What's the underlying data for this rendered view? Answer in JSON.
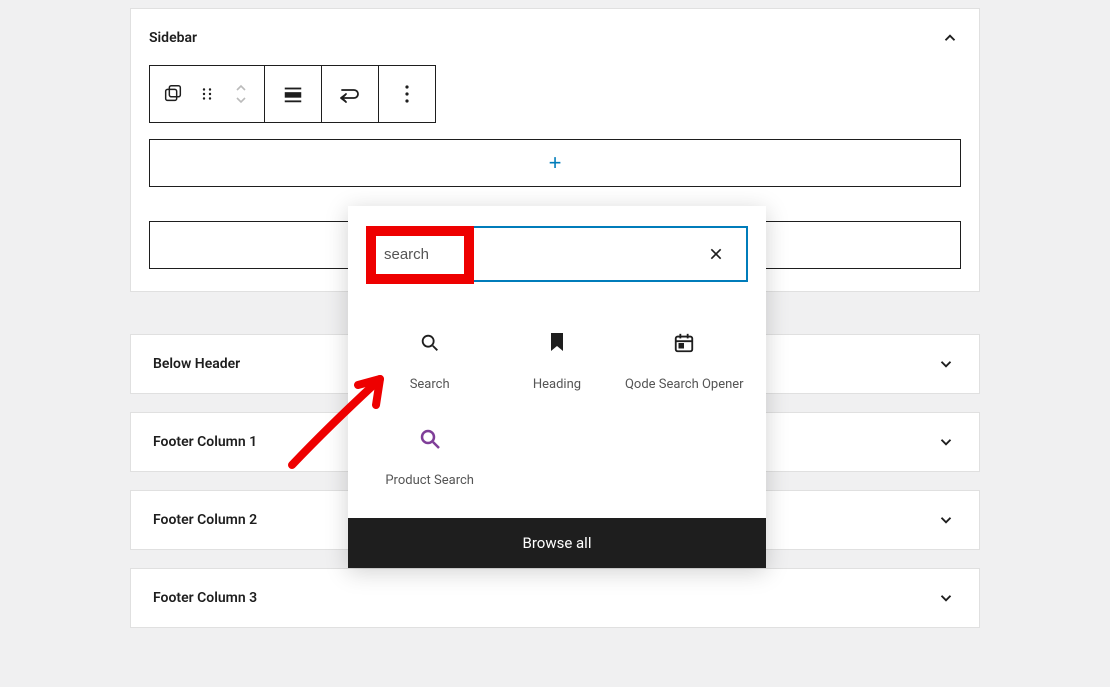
{
  "sidebar": {
    "title": "Sidebar"
  },
  "inserter": {
    "search_value": "search",
    "search_placeholder": "Search",
    "browse_all": "Browse all",
    "blocks": [
      {
        "label": "Search",
        "icon": "search"
      },
      {
        "label": "Heading",
        "icon": "bookmark"
      },
      {
        "label": "Qode Search Opener",
        "icon": "calendar"
      },
      {
        "label": "Product Search",
        "icon": "magnify-purple"
      }
    ]
  },
  "collapsed_panels": [
    "Below Header",
    "Footer Column 1",
    "Footer Column 2",
    "Footer Column 3"
  ]
}
